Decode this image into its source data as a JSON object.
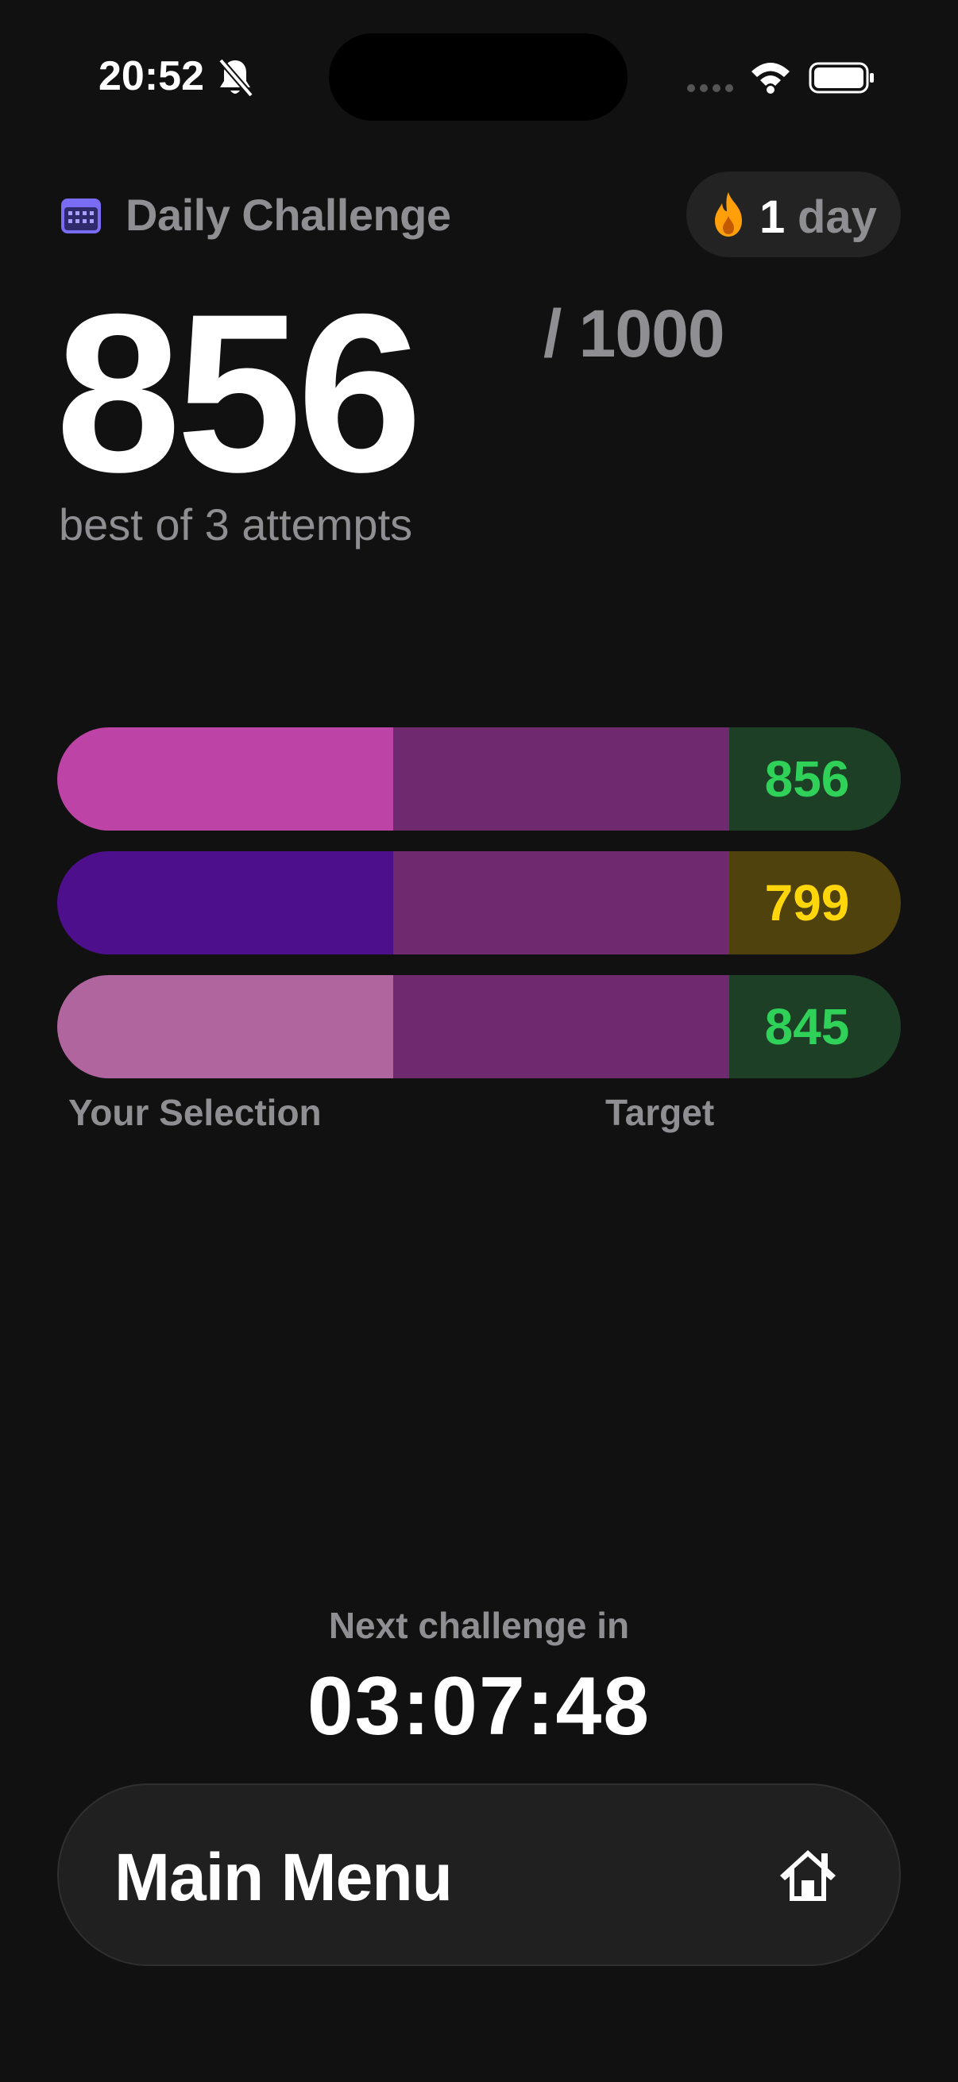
{
  "status_bar": {
    "time": "20:52",
    "icons": [
      "bell-slash-icon",
      "signal-dots-icon",
      "wifi-icon",
      "battery-icon"
    ]
  },
  "header": {
    "title": "Daily Challenge",
    "icon": "calendar-icon",
    "streak": {
      "icon": "flame-icon",
      "count": "1",
      "unit": "day"
    }
  },
  "score": {
    "value": "856",
    "total": "/ 1000",
    "subtitle": "best of 3 attempts"
  },
  "attempts": [
    {
      "selection_color": "#bd44a6",
      "target_color": "#6f2a6f",
      "score": "856",
      "score_color": "#30d158",
      "score_bg": "#1c3f25"
    },
    {
      "selection_color": "#4e0f8c",
      "target_color": "#6f2a6f",
      "score": "799",
      "score_color": "#ffd60a",
      "score_bg": "#4f420d"
    },
    {
      "selection_color": "#b1659e",
      "target_color": "#6f2a6f",
      "score": "845",
      "score_color": "#30d158",
      "score_bg": "#1c3f25"
    }
  ],
  "labels": {
    "selection": "Your Selection",
    "target": "Target"
  },
  "countdown": {
    "label": "Next challenge in",
    "time": "03:07:48"
  },
  "main_menu": {
    "label": "Main Menu",
    "icon": "house-icon"
  },
  "colors": {
    "background": "#111111",
    "accent_calendar": "#7b6cf6",
    "flame": "#ff9f0a"
  }
}
